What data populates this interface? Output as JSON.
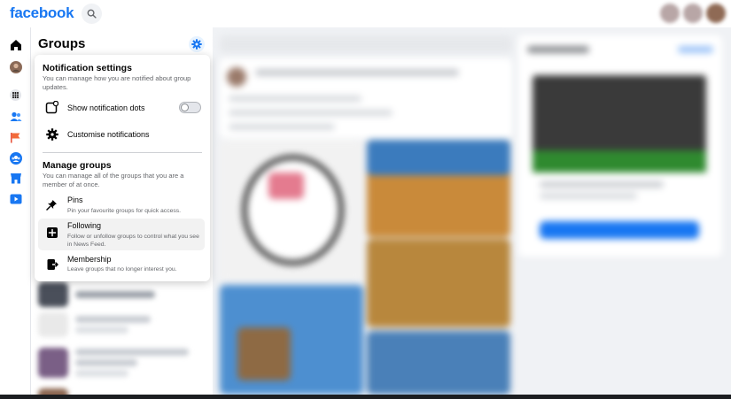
{
  "header": {
    "logo_text": "facebook",
    "brand_color": "#1877f2"
  },
  "rail": {
    "items": [
      "home-icon",
      "profile-avatar",
      "apps-grid-icon",
      "friends-icon",
      "pages-flag-icon",
      "groups-icon",
      "marketplace-icon",
      "watch-icon"
    ]
  },
  "sidebar": {
    "title": "Groups"
  },
  "menu": {
    "notification": {
      "title": "Notification settings",
      "description": "You can manage how you are notified about group updates.",
      "items": [
        {
          "label": "Show notification dots",
          "toggle_on": false
        },
        {
          "label": "Customise notifications"
        }
      ]
    },
    "manage": {
      "title": "Manage groups",
      "description": "You can manage all of the groups that you are a member of at once.",
      "items": [
        {
          "label": "Pins",
          "sub": "Pin your favourite groups for quick access."
        },
        {
          "label": "Following",
          "sub": "Follow or unfollow groups to control what you see in News Feed."
        },
        {
          "label": "Membership",
          "sub": "Leave groups that no longer interest you."
        }
      ]
    }
  }
}
